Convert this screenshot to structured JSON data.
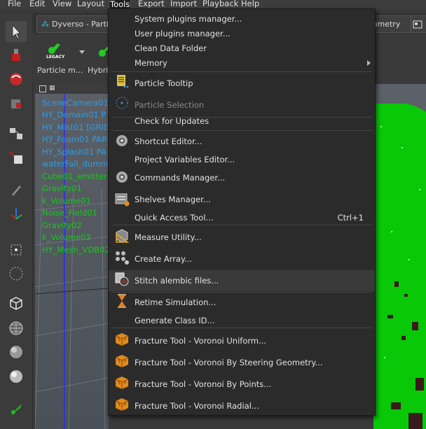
{
  "menubar": {
    "items": [
      "File",
      "Edit",
      "View",
      "Layout",
      "Tools",
      "Export",
      "Import",
      "Playback",
      "Help"
    ],
    "active": "Tools"
  },
  "tabs": {
    "left_tab": "Dyverso - Parti",
    "right_tab": "eometry"
  },
  "shelf": {
    "items": [
      "Particle m...",
      "Hybric"
    ],
    "legacy_badge": "LEGACY"
  },
  "outliner": {
    "items": [
      {
        "label": "SceneCamera01",
        "color": "#2e9ce8"
      },
      {
        "label": "HY_Domain01 P",
        "color": "#2e9ce8"
      },
      {
        "label": "HY_Mist01 [GRID",
        "color": "#2e9ce8"
      },
      {
        "label": "HY_Foam01 PAR",
        "color": "#2e9ce8"
      },
      {
        "label": "HY_Splash01 PA",
        "color": "#2e9ce8"
      },
      {
        "label": "waterFall_dumm",
        "color": "#2e9ce8"
      },
      {
        "label": "Cube01_emitter",
        "color": "#17c81b"
      },
      {
        "label": "Gravity01",
        "color": "#17c81b"
      },
      {
        "label": "k_Volume01",
        "color": "#17c81b"
      },
      {
        "label": "Noise_Field01",
        "color": "#17c81b"
      },
      {
        "label": "Gravity02",
        "color": "#17c81b"
      },
      {
        "label": "k_Volume03",
        "color": "#17c81b"
      },
      {
        "label": "HY_Mesh_VDB02",
        "color": "#17c81b"
      }
    ]
  },
  "tools_menu": {
    "system_plugins": "System plugins manager...",
    "user_plugins": "User plugins manager...",
    "clean_data": "Clean Data Folder",
    "memory": "Memory",
    "particle_tooltip": "Particle Tooltip",
    "particle_selection": "Particle Selection",
    "check_updates": "Check for Updates",
    "shortcut_editor": "Shortcut Editor...",
    "project_variables": "Project Variables Editor...",
    "commands_manager": "Commands Manager...",
    "shelves_manager": "Shelves Manager...",
    "quick_access": "Quick Access Tool...",
    "quick_access_shortcut": "Ctrl+1",
    "measure_utility": "Measure Utility...",
    "create_array": "Create Array...",
    "stitch_alembic": "Stitch alembic files...",
    "retime_simulation": "Retime Simulation...",
    "generate_class_id": "Generate Class ID...",
    "fracture_uniform": "Fracture Tool - Voronoi Uniform...",
    "fracture_steering": "Fracture Tool - Voronoi By Steering Geometry...",
    "fracture_points": "Fracture Tool - Voronoi By Points...",
    "fracture_radial": "Fracture Tool - Voronoi Radial..."
  },
  "colors": {
    "accent_green": "#17c81b",
    "accent_blue": "#2e9ce8",
    "menu_bg": "#2b2b2b",
    "fracture_orange": "#e08a1e"
  }
}
